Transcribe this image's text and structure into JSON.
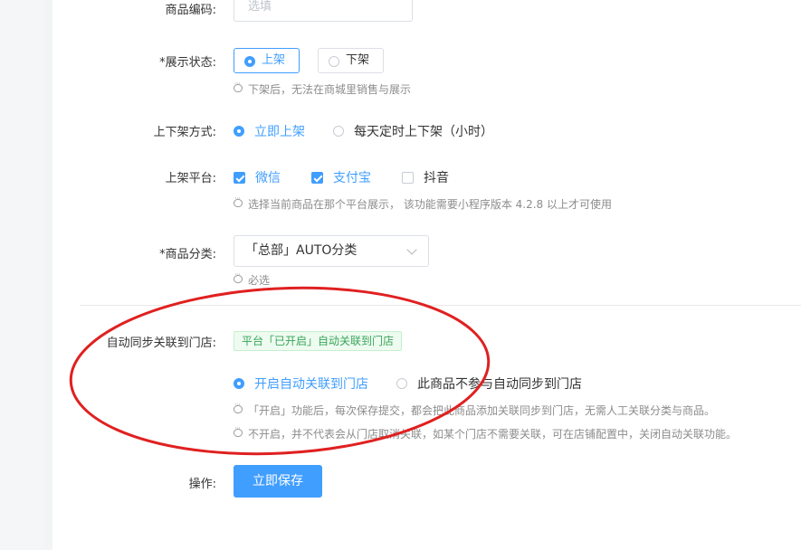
{
  "fields": {
    "code": {
      "label": "商品编码:",
      "placeholder": "选填"
    },
    "status": {
      "label": "*展示状态:",
      "options": [
        "上架",
        "下架"
      ],
      "selected": "上架",
      "hint": "下架后，无法在商城里销售与展示"
    },
    "shelf_mode": {
      "label": "上下架方式:",
      "options": [
        "立即上架",
        "每天定时上下架（小时）"
      ],
      "selected": "立即上架"
    },
    "platform": {
      "label": "上架平台:",
      "options": [
        {
          "label": "微信",
          "checked": true
        },
        {
          "label": "支付宝",
          "checked": true
        },
        {
          "label": "抖音",
          "checked": false
        }
      ],
      "hint": "选择当前商品在那个平台展示， 该功能需要小程序版本 4.2.8 以上才可使用"
    },
    "category": {
      "label": "*商品分类:",
      "value": "「总部」AUTO分类",
      "hint": "必选"
    },
    "auto_sync": {
      "label": "自动同步关联到门店:",
      "tag": "平台「已开启」自动关联到门店",
      "options": [
        "开启自动关联到门店",
        "此商品不参与自动同步到门店"
      ],
      "selected": "开启自动关联到门店",
      "hints": [
        "「开启」功能后，每次保存提交，都会把此商品添加关联同步到门店，无需人工关联分类与商品。",
        "不开启，并不代表会从门店取消关联，如某个门店不需要关联，可在店铺配置中，关闭自动关联功能。"
      ]
    },
    "action": {
      "label": "操作:",
      "save_label": "立即保存"
    }
  },
  "colors": {
    "primary": "#409eff",
    "annotation": "#e02020",
    "tag_green": "#3aa55a"
  },
  "icons": [
    "comment-icon",
    "chevron-down-icon"
  ]
}
